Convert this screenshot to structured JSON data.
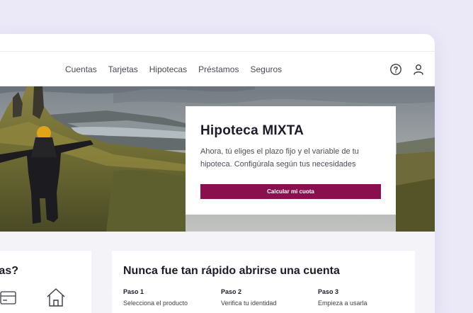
{
  "nav": {
    "items": [
      {
        "label": "Cuentas"
      },
      {
        "label": "Tarjetas"
      },
      {
        "label": "Hipotecas"
      },
      {
        "label": "Préstamos"
      },
      {
        "label": "Seguros"
      }
    ],
    "icons": [
      "help-circle-icon",
      "user-icon"
    ]
  },
  "hero": {
    "title": "Hipoteca MIXTA",
    "text": "Ahora, tú eliges el plazo fijo y el variable de tu hipoteca. Configúrala según tus necesidades",
    "button_label": "Calcular mi cuota"
  },
  "left_card": {
    "title_fragment": "tas?",
    "icons": [
      "credit-card-icon",
      "home-icon"
    ]
  },
  "accounts_card": {
    "title": "Nunca fue tan rápido abrirse una cuenta",
    "steps": [
      {
        "label": "Paso 1",
        "description": "Selecciona el producto"
      },
      {
        "label": "Paso 2",
        "description": "Verifica tu identidad"
      },
      {
        "label": "Paso 3",
        "description": "Empieza a usarla"
      }
    ]
  },
  "colors": {
    "accent": "#8a0f4e",
    "page_background": "#ebe9f8",
    "content_background": "#f4f3f8"
  }
}
